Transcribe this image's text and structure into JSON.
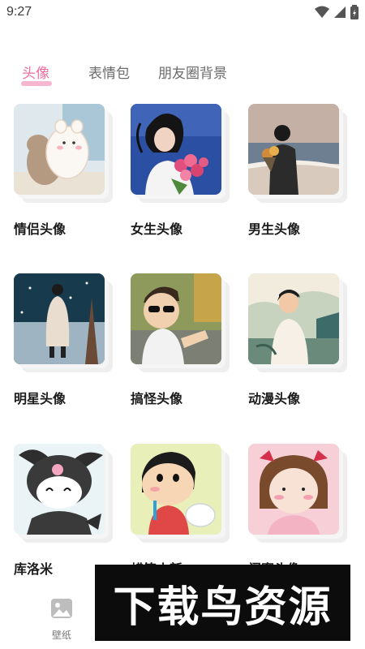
{
  "status_bar": {
    "time": "9:27"
  },
  "tabs": [
    {
      "label": "头像",
      "active": true
    },
    {
      "label": "表情包",
      "active": false
    },
    {
      "label": "朋友圈背景",
      "active": false
    }
  ],
  "categories": [
    {
      "label": "情侣头像",
      "image": "couple-bears"
    },
    {
      "label": "女生头像",
      "image": "girl-with-roses"
    },
    {
      "label": "男生头像",
      "image": "boy-at-beach"
    },
    {
      "label": "明星头像",
      "image": "star-in-snow"
    },
    {
      "label": "搞怪头像",
      "image": "kid-with-sunglasses"
    },
    {
      "label": "动漫头像",
      "image": "anime-boy"
    },
    {
      "label": "库洛米",
      "image": "kuromi"
    },
    {
      "label": "蜡笔小新",
      "image": "crayon-shinchan"
    },
    {
      "label": "闺蜜头像",
      "image": "bestie-girl"
    }
  ],
  "bottom_nav": {
    "wallpaper_label": "壁纸"
  },
  "watermark": {
    "text": "下载鸟资源"
  },
  "colors": {
    "accent": "#f26da0",
    "underline": "#f7b6cf"
  }
}
